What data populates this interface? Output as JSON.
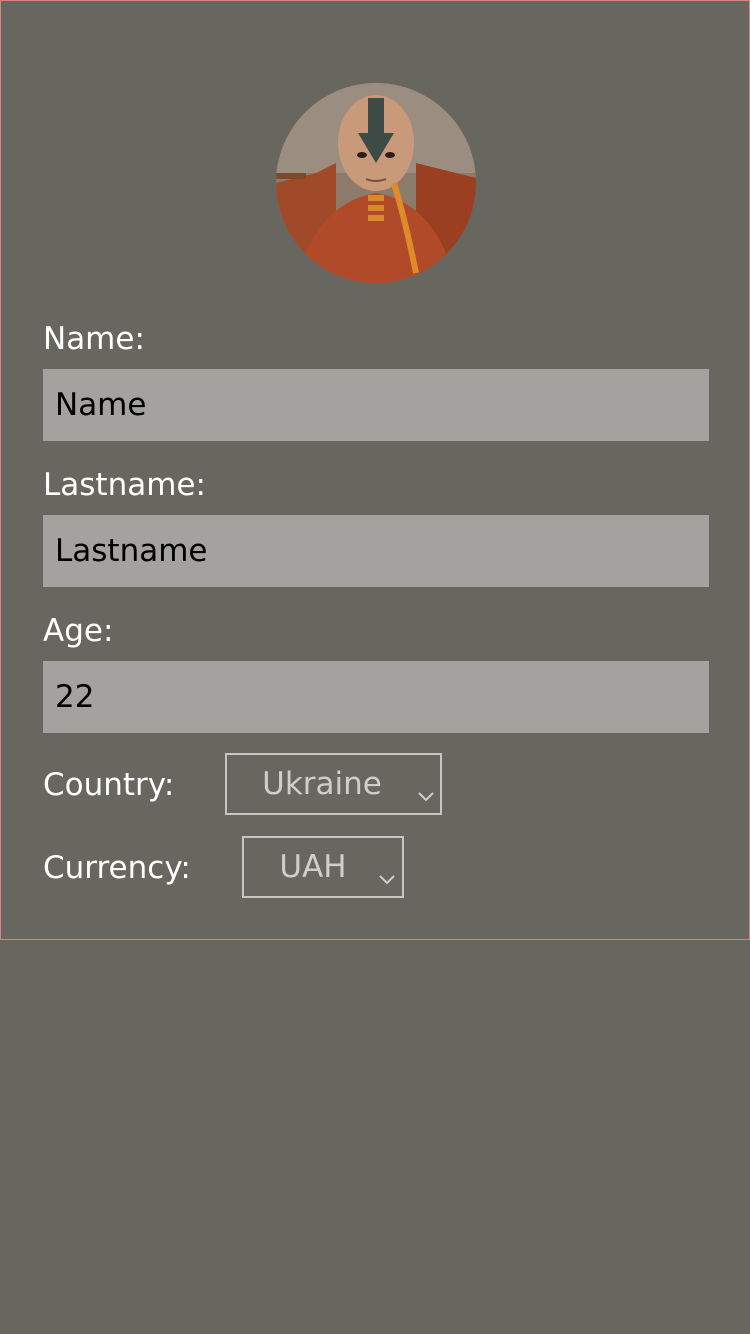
{
  "profile": {
    "avatar_icon": "profile-photo"
  },
  "form": {
    "name_label": "Name:",
    "name_value": "Name",
    "lastname_label": "Lastname:",
    "lastname_value": "Lastname",
    "age_label": "Age:",
    "age_value": "22",
    "country_label": "Country:",
    "country_value": "Ukraine",
    "currency_label": "Currency:",
    "currency_value": "UAH"
  },
  "colors": {
    "background": "#67665f",
    "panel_border": "#d98380",
    "input_fill": "#a3a29e",
    "label_text": "#ffffff"
  }
}
